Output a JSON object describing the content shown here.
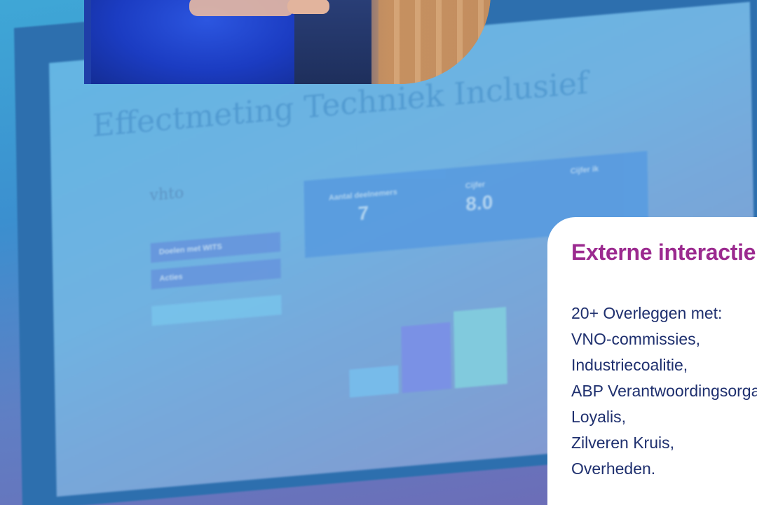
{
  "background_screen": {
    "title": "Effectmeting Techniek Inclusief",
    "logo": "vhto",
    "stats": [
      {
        "label": "Aantal deelnemers",
        "value": "7"
      },
      {
        "label": "Cijfer",
        "value": "8.0"
      },
      {
        "label": "Cijfer ik",
        "value": ""
      }
    ],
    "buttons": [
      "Doelen met WITS",
      "Acties"
    ]
  },
  "card": {
    "title": "Externe interactie",
    "lines": [
      "20+ Overleggen met:",
      "VNO-commissies,",
      "Industriecoalitie,",
      "ABP Verantwoordingsorgaan,",
      "Loyalis,",
      "Zilveren Kruis,",
      "Overheden."
    ]
  },
  "colors": {
    "card_title": "#9b2a8f",
    "card_text": "#1e2f6e",
    "background_top": "#3fa7d6",
    "background_bottom": "#6e6ab5"
  }
}
